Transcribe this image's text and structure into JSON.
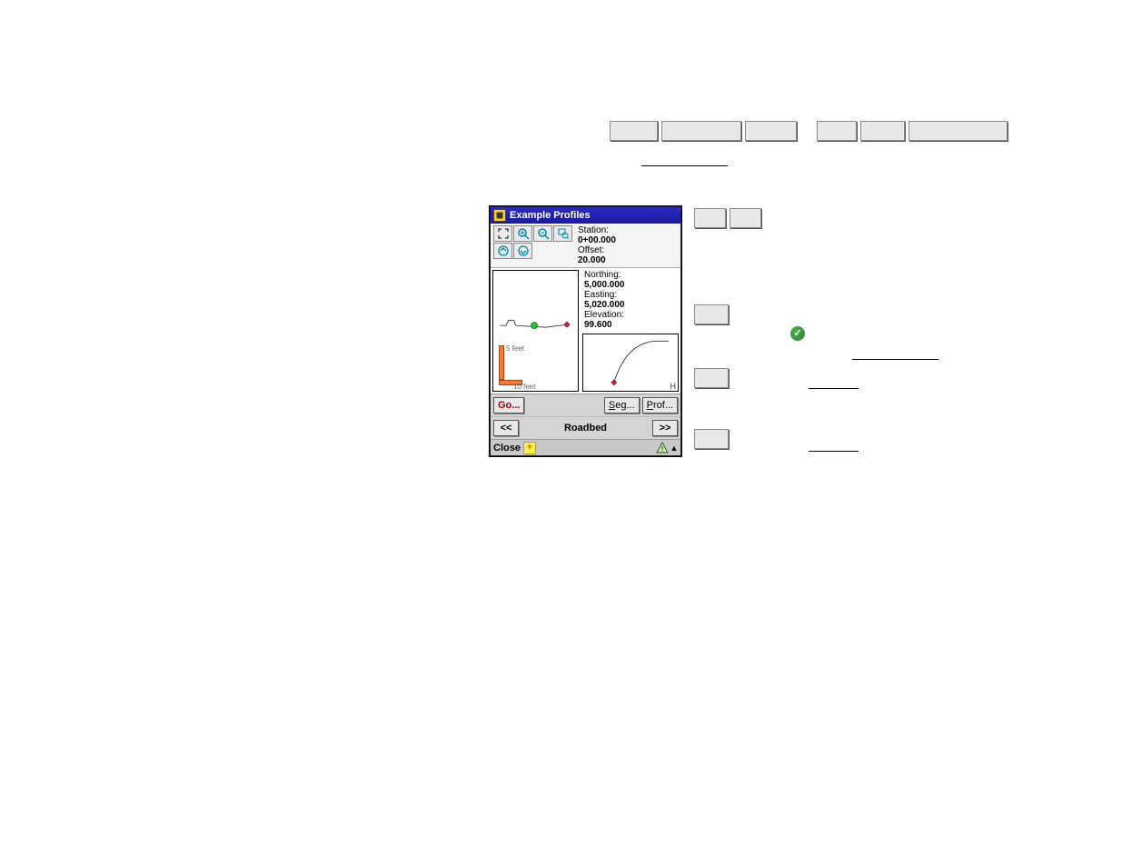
{
  "toolbar": {
    "row1": [
      "",
      "",
      "",
      "",
      "",
      ""
    ],
    "row1b": [
      "",
      ""
    ]
  },
  "device": {
    "title": "Example Profiles",
    "info": {
      "station_label": "Station:",
      "station_value": "0+00.000",
      "offset_label": "Offset:",
      "offset_value": "20.000",
      "northing_label": "Northing:",
      "northing_value": "5,000.000",
      "easting_label": "Easting:",
      "easting_value": "5,020.000",
      "elevation_label": "Elevation:",
      "elevation_value": "99.600"
    },
    "scale": {
      "vertical": "5 feet",
      "horizontal": "10 feet"
    },
    "cross_h_label": "H",
    "buttons": {
      "go": "Go...",
      "seg": "Seg...",
      "seg_u": "S",
      "seg_rest": "eg...",
      "prof": "Prof...",
      "prof_u": "P",
      "prof_rest": "rof...",
      "prev": "<<",
      "next": ">>"
    },
    "segment_name": "Roadbed",
    "status": {
      "close": "Close"
    }
  }
}
